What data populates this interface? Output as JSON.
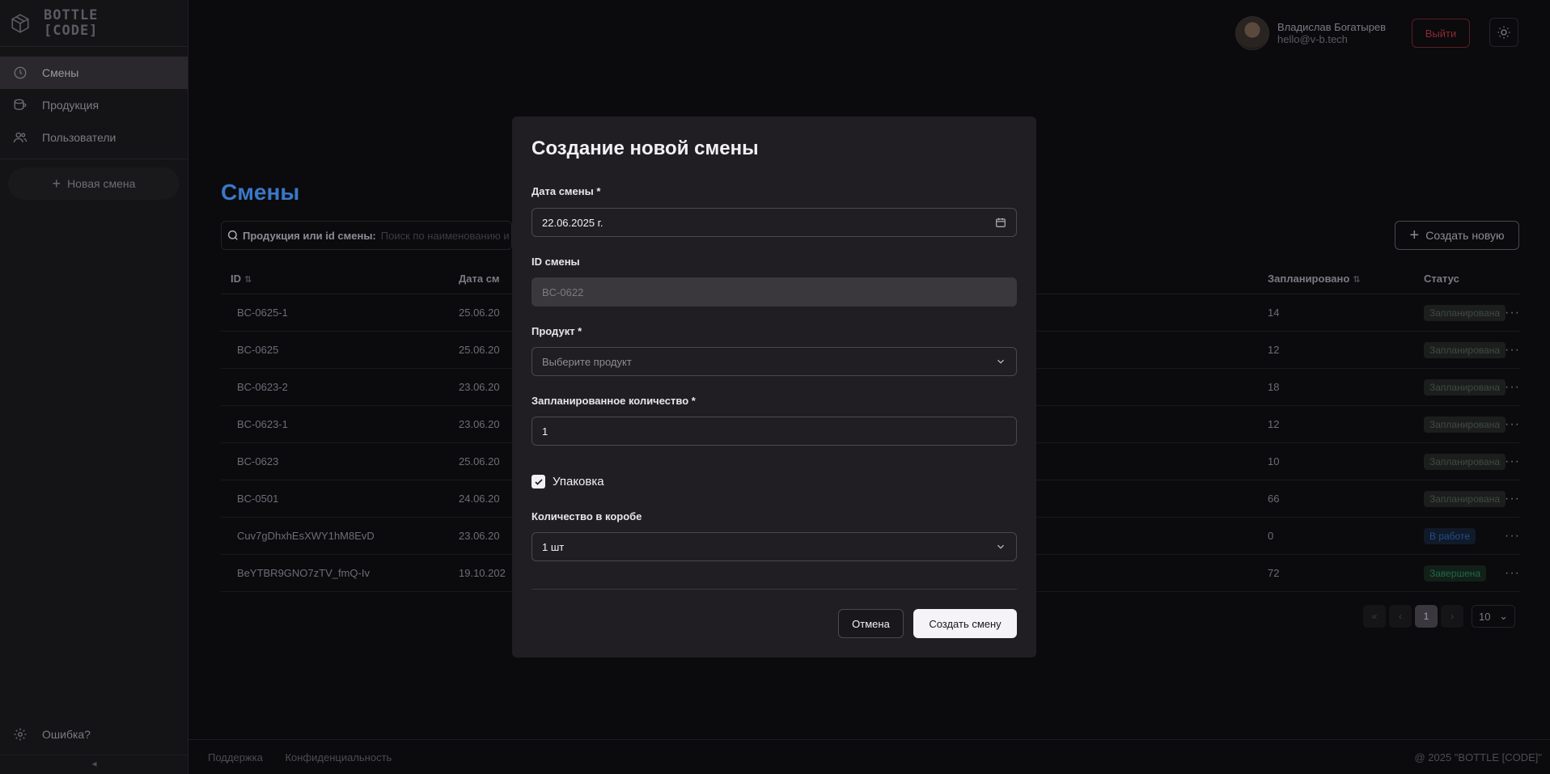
{
  "brand": {
    "line1": "BOTTLE",
    "line2": "[CODE]"
  },
  "sidebar": {
    "items": [
      {
        "label": "Смены",
        "icon": "clock-icon"
      },
      {
        "label": "Продукция",
        "icon": "product-icon"
      },
      {
        "label": "Пользователи",
        "icon": "users-icon"
      }
    ],
    "new_shift": "Новая смена",
    "bug_report": "Ошибка?",
    "collapse": "◂"
  },
  "header": {
    "user_name": "Владислав Богатырев",
    "user_email": "hello@v-b.tech",
    "logout": "Выйти"
  },
  "page": {
    "title": "Смены",
    "search_label": "Продукция или id смены:",
    "search_placeholder": "Поиск по наименованию и",
    "create_new": "Создать новую"
  },
  "table": {
    "headers": {
      "id": "ID",
      "date": "Дата см",
      "planned": "Запланировано",
      "status": "Статус"
    },
    "rows": [
      {
        "id": "BC-0625-1",
        "date": "25.06.20",
        "planned": "14",
        "status": "Запланирована",
        "kind": "planned"
      },
      {
        "id": "BC-0625",
        "date": "25.06.20",
        "planned": "12",
        "status": "Запланирована",
        "kind": "planned"
      },
      {
        "id": "BC-0623-2",
        "date": "23.06.20",
        "planned": "18",
        "status": "Запланирована",
        "kind": "planned"
      },
      {
        "id": "BC-0623-1",
        "date": "23.06.20",
        "planned": "12",
        "status": "Запланирована",
        "kind": "planned"
      },
      {
        "id": "BC-0623",
        "date": "25.06.20",
        "planned": "10",
        "status": "Запланирована",
        "kind": "planned"
      },
      {
        "id": "BC-0501",
        "date": "24.06.20",
        "planned": "66",
        "status": "Запланирована",
        "kind": "planned"
      },
      {
        "id": "Cuv7gDhxhEsXWY1hM8EvD",
        "date": "23.06.20",
        "planned": "0",
        "status": "В работе",
        "kind": "work"
      },
      {
        "id": "BeYTBR9GNO7zTV_fmQ-Iv",
        "date": "19.10.202",
        "planned": "72",
        "status": "Завершена",
        "kind": "done"
      }
    ]
  },
  "pager": {
    "current": "1",
    "size": "10"
  },
  "footer": {
    "support": "Поддержка",
    "privacy": "Конфиденциальность",
    "copyright": "@ 2025 \"BOTTLE [CODE]\""
  },
  "modal": {
    "title": "Создание новой смены",
    "date_label": "Дата смены *",
    "date_value": "22.06.2025 г.",
    "id_label": "ID смены",
    "id_value": "BC-0622",
    "product_label": "Продукт *",
    "product_placeholder": "Выберите продукт",
    "qty_label": "Запланированное количество *",
    "qty_value": "1",
    "packing_label": "Упаковка",
    "box_label": "Количество в коробе",
    "box_value": "1 шт",
    "cancel": "Отмена",
    "submit": "Создать смену"
  }
}
